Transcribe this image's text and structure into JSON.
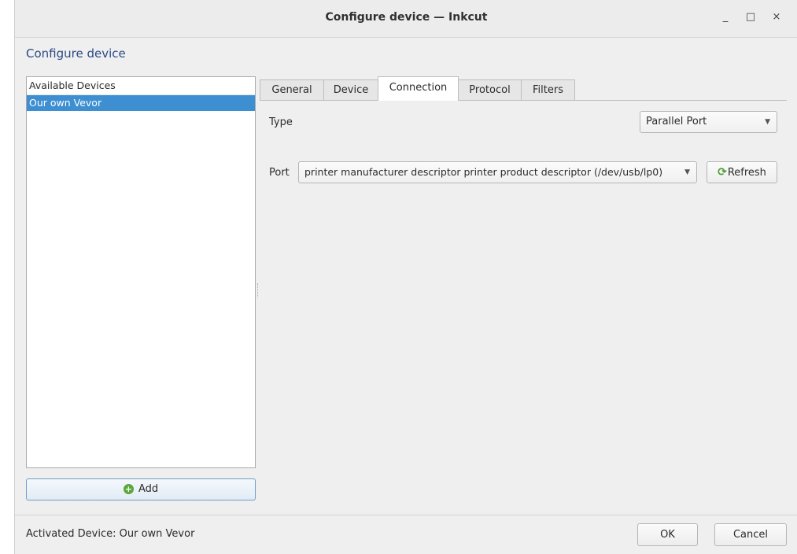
{
  "window": {
    "title": "Configure device — Inkcut",
    "minimize": "_",
    "maximize": "□",
    "close": "×"
  },
  "heading": "Configure device",
  "devices": {
    "header": "Available Devices",
    "items": [
      "Our own Vevor"
    ],
    "selected_index": 0
  },
  "add_button": {
    "label": "Add",
    "icon": "plus-circle-icon"
  },
  "tabs": [
    "General",
    "Device",
    "Connection",
    "Protocol",
    "Filters"
  ],
  "active_tab": "Connection",
  "connection": {
    "type_label": "Type",
    "type_value": "Parallel Port",
    "port_label": "Port",
    "port_value": "printer manufacturer descriptor printer product descriptor (/dev/usb/lp0)",
    "refresh_label": "Refresh",
    "refresh_icon": "refresh-icon"
  },
  "status": "Activated Device: Our own Vevor",
  "buttons": {
    "ok": "OK",
    "cancel": "Cancel"
  },
  "colors": {
    "selection": "#3d8fd1",
    "heading": "#2d4a86",
    "add_border": "#6f9dc8"
  }
}
